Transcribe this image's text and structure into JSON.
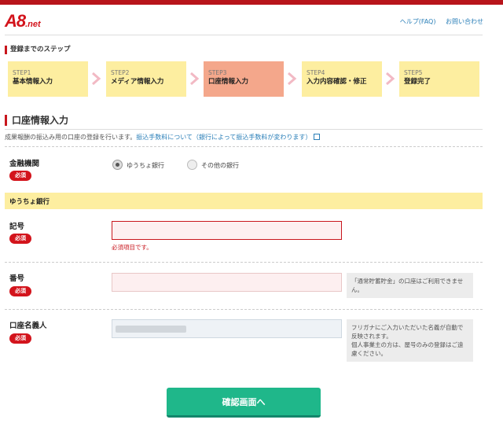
{
  "header": {
    "logo_main": "A8",
    "logo_sub": ".net",
    "help_link": "ヘルプ(FAQ)",
    "contact_link": "お問い合わせ",
    "brand_color": "#d3141c"
  },
  "steps_section": {
    "title": "登録までのステップ",
    "items": [
      {
        "num": "STEP1",
        "label": "基本情報入力"
      },
      {
        "num": "STEP2",
        "label": "メディア情報入力"
      },
      {
        "num": "STEP3",
        "label": "口座情報入力",
        "active": true
      },
      {
        "num": "STEP4",
        "label": "入力内容確認・修正"
      },
      {
        "num": "STEP5",
        "label": "登録完了"
      }
    ]
  },
  "main": {
    "title": "口座情報入力",
    "intro_text": "成果報酬の振込み用の口座の登録を行います。",
    "intro_link": "振込手数料について（銀行によって振込手数料が変わります）"
  },
  "form": {
    "bank": {
      "label": "金融機関",
      "required": "必須",
      "options": [
        "ゆうちょ銀行",
        "その他の銀行"
      ],
      "selected": "ゆうちょ銀行"
    },
    "yucho_header": "ゆうちょ銀行",
    "kigou": {
      "label": "記号",
      "required": "必須",
      "value": "",
      "error": "必須項目です。"
    },
    "bangou": {
      "label": "番号",
      "required": "必須",
      "value": "",
      "hint": "「通常貯蓄貯金」の口座はご利用できません。"
    },
    "holder": {
      "label": "口座名義人",
      "required": "必須",
      "hint_lines": [
        "フリガナにご入力いただいた名義が自動で反映されます。",
        "個人事業主の方は、屋号のみの登録はご遠慮ください。"
      ]
    },
    "submit_label": "確認画面へ",
    "submit_color": "#1fb78a"
  }
}
